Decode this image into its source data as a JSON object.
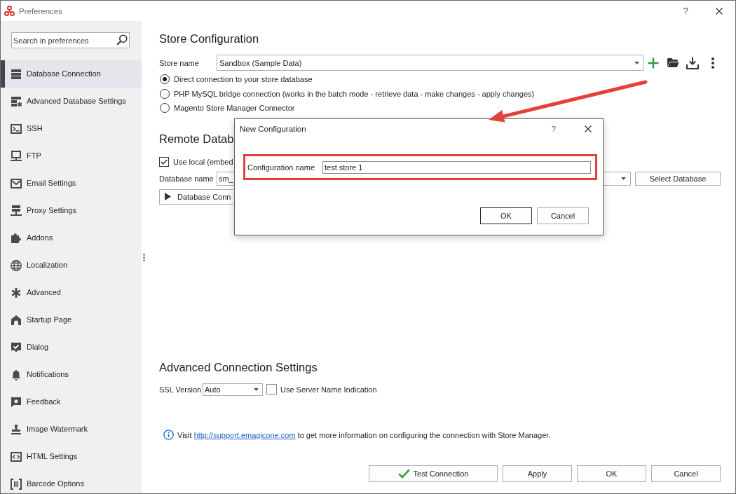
{
  "window": {
    "title": "Preferences",
    "help_button": "?"
  },
  "sidebar": {
    "search": {
      "placeholder": "Search in preferences"
    },
    "items": [
      {
        "label": "Database Connection",
        "selected": true
      },
      {
        "label": "Advanced Database Settings",
        "selected": false
      },
      {
        "label": "SSH",
        "selected": false
      },
      {
        "label": "FTP",
        "selected": false
      },
      {
        "label": "Email Settings",
        "selected": false
      },
      {
        "label": "Proxy Settings",
        "selected": false
      },
      {
        "label": "Addons",
        "selected": false
      },
      {
        "label": "Localization",
        "selected": false
      },
      {
        "label": "Advanced",
        "selected": false
      },
      {
        "label": "Startup Page",
        "selected": false
      },
      {
        "label": "Dialog",
        "selected": false
      },
      {
        "label": "Notifications",
        "selected": false
      },
      {
        "label": "Feedback",
        "selected": false
      },
      {
        "label": "Image Watermark",
        "selected": false
      },
      {
        "label": "HTML Settings",
        "selected": false
      },
      {
        "label": "Barcode Options",
        "selected": false
      }
    ]
  },
  "store_configuration": {
    "heading": "Store Configuration",
    "store_name": {
      "label": "Store name",
      "value": "Sandbox (Sample Data)"
    },
    "connection_types": [
      {
        "label": "Direct connection to your store database",
        "selected": true
      },
      {
        "label": "PHP MySQL bridge connection (works in the batch mode - retrieve data - make changes - apply changes)",
        "selected": false
      },
      {
        "label": "Magento Store Manager Connector",
        "selected": false
      }
    ]
  },
  "remote_database": {
    "heading": "Remote Datab",
    "use_local": {
      "label": "Use local (embed",
      "checked": true
    },
    "database_name": {
      "label": "Database name",
      "value": "sm_"
    },
    "select_button": "Select Database",
    "details_button": {
      "label": "Database Conn",
      "expanded": false
    }
  },
  "advanced_connection_settings": {
    "heading": "Advanced Connection Settings",
    "ssl_version": {
      "label": "SSL Version",
      "value": "Auto"
    },
    "server_name_indication": {
      "label": "Use Server Name Indication",
      "checked": false
    }
  },
  "info": {
    "text_before": "Visit",
    "link": "http://support.emagicone.com",
    "text_after": "to get more information on configuring the connection with Store Manager."
  },
  "buttons": [
    {
      "label": "Test Connection",
      "kind": "check"
    },
    {
      "label": "Apply",
      "kind": "plain"
    },
    {
      "label": "OK",
      "kind": "plain"
    },
    {
      "label": "Cancel",
      "kind": "plain"
    }
  ],
  "dialog": {
    "title": "New Configuration",
    "help_button": "?",
    "configuration_name": {
      "label": "Configuration name",
      "value": "test store 1"
    },
    "buttons": [
      {
        "label": "OK",
        "focused": true
      },
      {
        "label": "Cancel",
        "focused": false
      }
    ]
  }
}
